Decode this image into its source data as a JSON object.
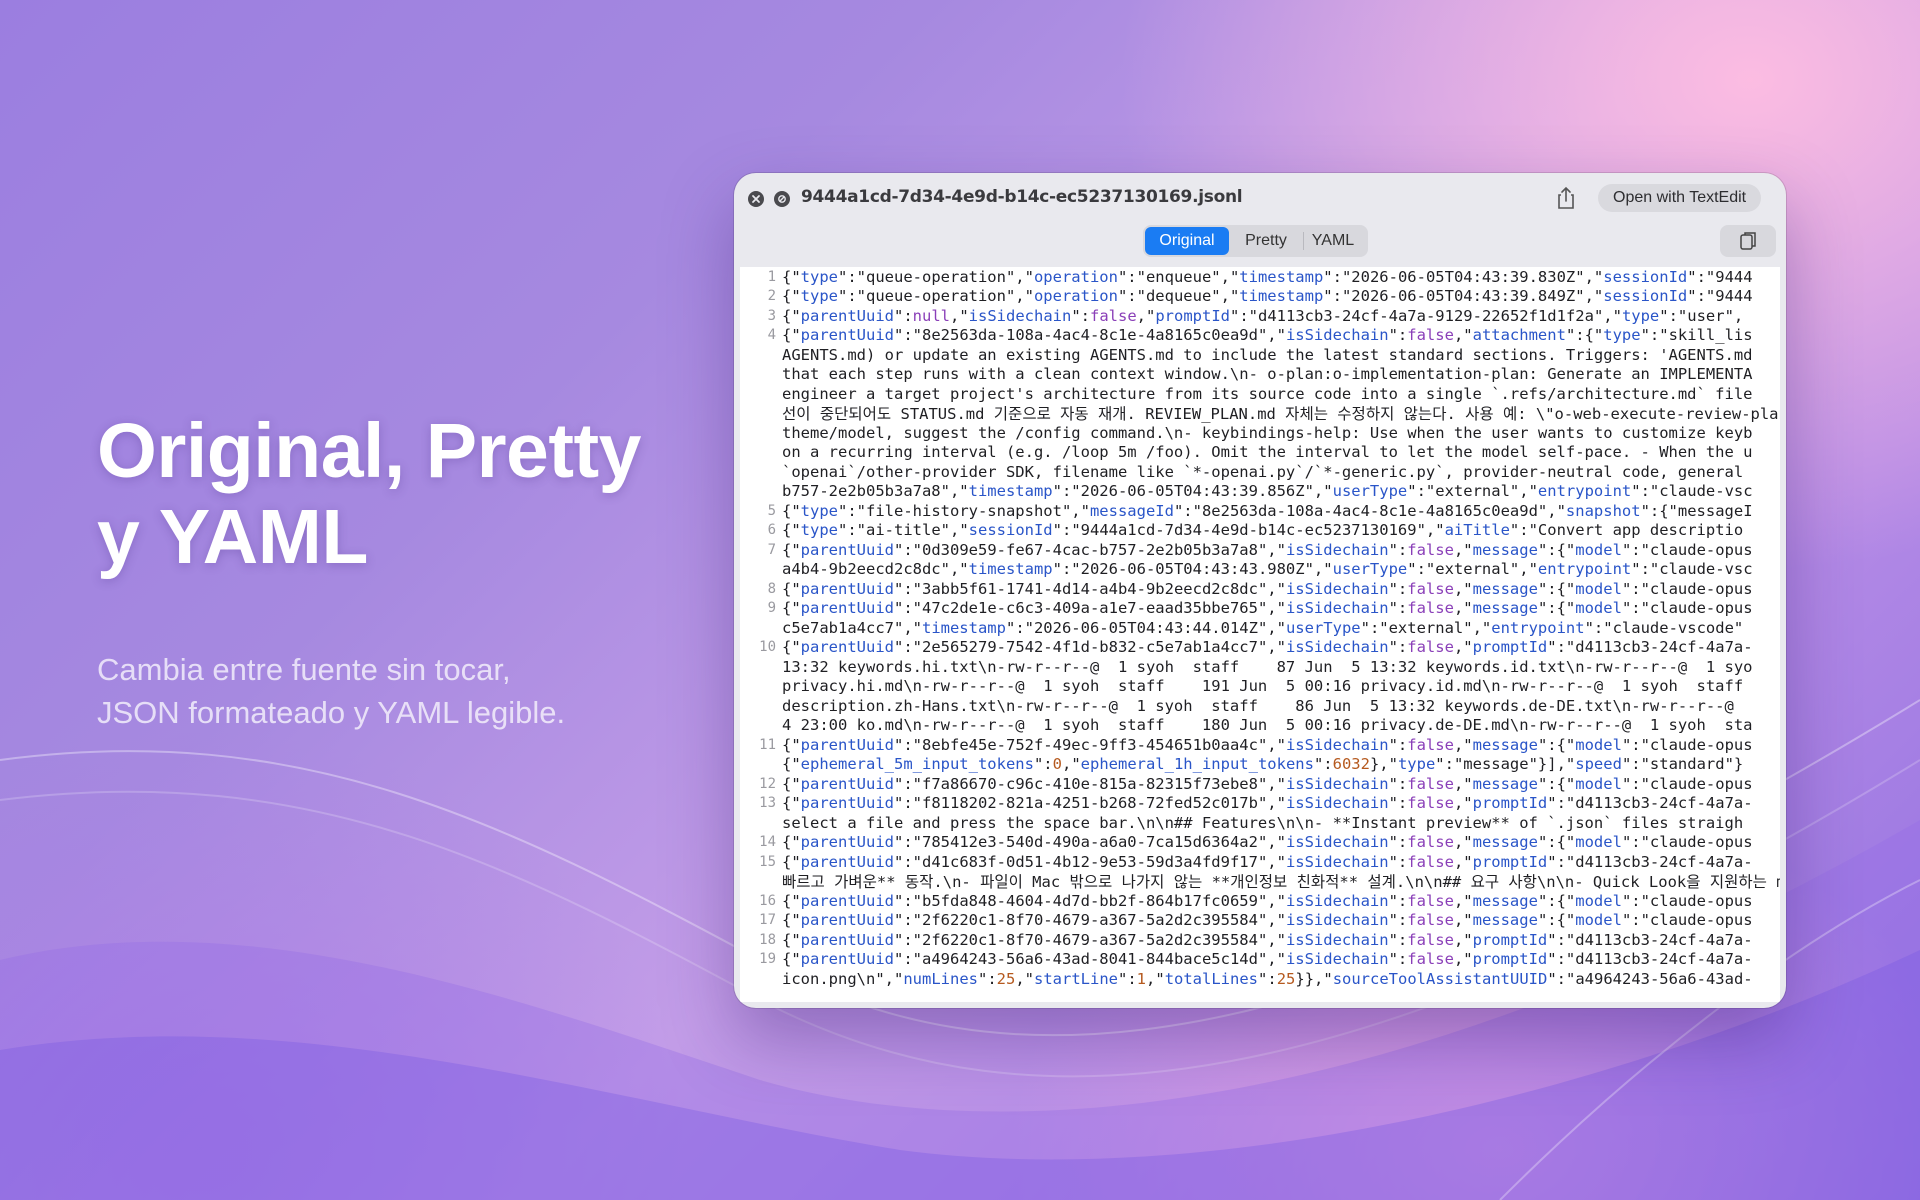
{
  "hero": {
    "title_line1": "Original, Pretty",
    "title_line2": "y YAML",
    "subtitle_line1": "Cambia entre fuente sin tocar,",
    "subtitle_line2": "JSON formateado y YAML legible."
  },
  "window": {
    "filename": "9444a1cd-7d34-4e9d-b14c-ec5237130169.jsonl",
    "open_button": "Open with TextEdit",
    "tabs": [
      {
        "label": "Original",
        "active": true
      },
      {
        "label": "Pretty",
        "active": false
      },
      {
        "label": "YAML",
        "active": false
      }
    ],
    "accent_color": "#1a7cf3"
  },
  "editor": {
    "lines": [
      {
        "num": "1",
        "text": "{\"type\":\"queue-operation\",\"operation\":\"enqueue\",\"timestamp\":\"2026-06-05T04:43:39.830Z\",\"sessionId\":\"9444"
      },
      {
        "num": "2",
        "text": "{\"type\":\"queue-operation\",\"operation\":\"dequeue\",\"timestamp\":\"2026-06-05T04:43:39.849Z\",\"sessionId\":\"9444"
      },
      {
        "num": "3",
        "text": "{\"parentUuid\":null,\"isSidechain\":false,\"promptId\":\"d4113cb3-24cf-4a7a-9129-22652f1d1f2a\",\"type\":\"user\","
      },
      {
        "num": "4",
        "text": "{\"parentUuid\":\"8e2563da-108a-4ac4-8c1e-4a8165c0ea9d\",\"isSidechain\":false,\"attachment\":{\"type\":\"skill_lis"
      },
      {
        "num": "",
        "text": "AGENTS.md) or update an existing AGENTS.md to include the latest standard sections. Triggers: 'AGENTS.md"
      },
      {
        "num": "",
        "text": "that each step runs with a clean context window.\\n- o-plan:o-implementation-plan: Generate an IMPLEMENTA"
      },
      {
        "num": "",
        "text": "engineer a target project's architecture from its source code into a single `.refs/architecture.md` file"
      },
      {
        "num": "",
        "text": "선이 중단되어도 STATUS.md 기준으로 자동 재개. REVIEW_PLAN.md 자체는 수정하지 않는다. 사용 예: \\\"o-web-execute-review-plan"
      },
      {
        "num": "",
        "text": "theme/model, suggest the /config command.\\n- keybindings-help: Use when the user wants to customize keyb"
      },
      {
        "num": "",
        "text": "on a recurring interval (e.g. /loop 5m /foo). Omit the interval to let the model self-pace. - When the u"
      },
      {
        "num": "",
        "text": "`openai`/other-provider SDK, filename like `*-openai.py`/`*-generic.py`, provider-neutral code, general"
      },
      {
        "num": "",
        "text": "b757-2e2b05b3a7a8\",\"timestamp\":\"2026-06-05T04:43:39.856Z\",\"userType\":\"external\",\"entrypoint\":\"claude-vsc"
      },
      {
        "num": "5",
        "text": "{\"type\":\"file-history-snapshot\",\"messageId\":\"8e2563da-108a-4ac4-8c1e-4a8165c0ea9d\",\"snapshot\":{\"messageI"
      },
      {
        "num": "6",
        "text": "{\"type\":\"ai-title\",\"sessionId\":\"9444a1cd-7d34-4e9d-b14c-ec5237130169\",\"aiTitle\":\"Convert app descriptio"
      },
      {
        "num": "7",
        "text": "{\"parentUuid\":\"0d309e59-fe67-4cac-b757-2e2b05b3a7a8\",\"isSidechain\":false,\"message\":{\"model\":\"claude-opus"
      },
      {
        "num": "",
        "text": "a4b4-9b2eecd2c8dc\",\"timestamp\":\"2026-06-05T04:43:43.980Z\",\"userType\":\"external\",\"entrypoint\":\"claude-vsc"
      },
      {
        "num": "8",
        "text": "{\"parentUuid\":\"3abb5f61-1741-4d14-a4b4-9b2eecd2c8dc\",\"isSidechain\":false,\"message\":{\"model\":\"claude-opus"
      },
      {
        "num": "9",
        "text": "{\"parentUuid\":\"47c2de1e-c6c3-409a-a1e7-eaad35bbe765\",\"isSidechain\":false,\"message\":{\"model\":\"claude-opus"
      },
      {
        "num": "",
        "text": "c5e7ab1a4cc7\",\"timestamp\":\"2026-06-05T04:43:44.014Z\",\"userType\":\"external\",\"entrypoint\":\"claude-vscode\""
      },
      {
        "num": "10",
        "text": "{\"parentUuid\":\"2e565279-7542-4f1d-b832-c5e7ab1a4cc7\",\"isSidechain\":false,\"promptId\":\"d4113cb3-24cf-4a7a-"
      },
      {
        "num": "",
        "text": "13:32 keywords.hi.txt\\n-rw-r--r--@  1 syoh  staff    87 Jun  5 13:32 keywords.id.txt\\n-rw-r--r--@  1 syo"
      },
      {
        "num": "",
        "text": "privacy.hi.md\\n-rw-r--r--@  1 syoh  staff    191 Jun  5 00:16 privacy.id.md\\n-rw-r--r--@  1 syoh  staff"
      },
      {
        "num": "",
        "text": "description.zh-Hans.txt\\n-rw-r--r--@  1 syoh  staff    86 Jun  5 13:32 keywords.de-DE.txt\\n-rw-r--r--@"
      },
      {
        "num": "",
        "text": "4 23:00 ko.md\\n-rw-r--r--@  1 syoh  staff    180 Jun  5 00:16 privacy.de-DE.md\\n-rw-r--r--@  1 syoh  sta"
      },
      {
        "num": "11",
        "text": "{\"parentUuid\":\"8ebfe45e-752f-49ec-9ff3-454651b0aa4c\",\"isSidechain\":false,\"message\":{\"model\":\"claude-opus"
      },
      {
        "num": "",
        "text": "{\"ephemeral_5m_input_tokens\":0,\"ephemeral_1h_input_tokens\":6032},\"type\":\"message\"}],\"speed\":\"standard\"}"
      },
      {
        "num": "12",
        "text": "{\"parentUuid\":\"f7a86670-c96c-410e-815a-82315f73ebe8\",\"isSidechain\":false,\"message\":{\"model\":\"claude-opus"
      },
      {
        "num": "13",
        "text": "{\"parentUuid\":\"f8118202-821a-4251-b268-72fed52c017b\",\"isSidechain\":false,\"promptId\":\"d4113cb3-24cf-4a7a-"
      },
      {
        "num": "",
        "text": "select a file and press the space bar.\\n\\n## Features\\n\\n- **Instant preview** of `.json` files straigh"
      },
      {
        "num": "14",
        "text": "{\"parentUuid\":\"785412e3-540d-490a-a6a0-7ca15d6364a2\",\"isSidechain\":false,\"message\":{\"model\":\"claude-opus"
      },
      {
        "num": "15",
        "text": "{\"parentUuid\":\"d41c683f-0d51-4b12-9e53-59d3a4fd9f17\",\"isSidechain\":false,\"promptId\":\"d4113cb3-24cf-4a7a-"
      },
      {
        "num": "",
        "text": "빠르고 가벼운** 동작.\\n- 파일이 Mac 밖으로 나가지 않는 **개인정보 친화적** 설계.\\n\\n## 요구 사항\\n\\n- Quick Look을 지원하는 ma"
      },
      {
        "num": "16",
        "text": "{\"parentUuid\":\"b5fda848-4604-4d7d-bb2f-864b17fc0659\",\"isSidechain\":false,\"message\":{\"model\":\"claude-opus"
      },
      {
        "num": "17",
        "text": "{\"parentUuid\":\"2f6220c1-8f70-4679-a367-5a2d2c395584\",\"isSidechain\":false,\"message\":{\"model\":\"claude-opus"
      },
      {
        "num": "18",
        "text": "{\"parentUuid\":\"2f6220c1-8f70-4679-a367-5a2d2c395584\",\"isSidechain\":false,\"promptId\":\"d4113cb3-24cf-4a7a-"
      },
      {
        "num": "19",
        "text": "{\"parentUuid\":\"a4964243-56a6-43ad-8041-844bace5c14d\",\"isSidechain\":false,\"promptId\":\"d4113cb3-24cf-4a7a-"
      },
      {
        "num": "",
        "text": "icon.png\\n\",\"numLines\":25,\"startLine\":1,\"totalLines\":25}},\"sourceToolAssistantUUID\":\"a4964243-56a6-43ad-"
      }
    ]
  }
}
